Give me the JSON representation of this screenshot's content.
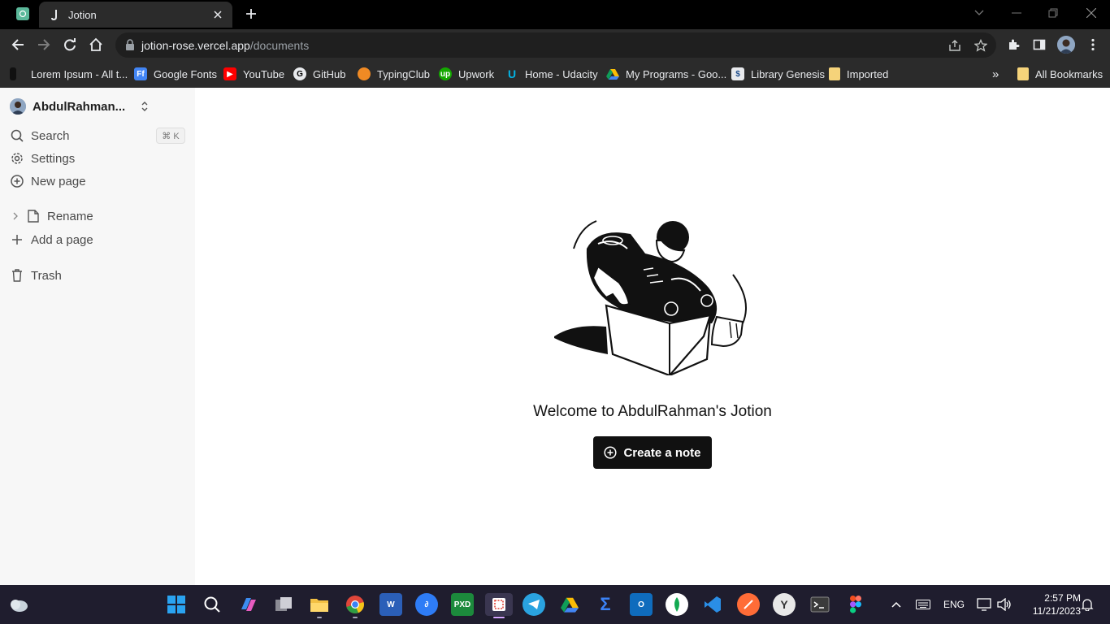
{
  "browser": {
    "tab_title": "Jotion",
    "url_host": "jotion-rose.vercel.app",
    "url_path": "/documents",
    "bookmarks": [
      {
        "label": "Lorem Ipsum - All t...",
        "icon": "lorem-icon",
        "color": "#333333"
      },
      {
        "label": "Google Fonts",
        "icon": "google-fonts-icon",
        "color": "#4285f4"
      },
      {
        "label": "YouTube",
        "icon": "youtube-icon",
        "color": "#ff0000"
      },
      {
        "label": "GitHub",
        "icon": "github-icon",
        "color": "#e8eaed"
      },
      {
        "label": "TypingClub",
        "icon": "typingclub-icon",
        "color": "#f08a24"
      },
      {
        "label": "Upwork",
        "icon": "upwork-icon",
        "color": "#14a800"
      },
      {
        "label": "Home - Udacity",
        "icon": "udacity-icon",
        "color": "#02b3e4"
      },
      {
        "label": "My Programs - Goo...",
        "icon": "google-drive-icon",
        "color": "#fbbc04"
      },
      {
        "label": "Library Genesis",
        "icon": "library-genesis-icon",
        "color": "#1f4e8c"
      },
      {
        "label": "Imported",
        "icon": "folder-icon",
        "color": "#f5d37a"
      }
    ],
    "all_bookmarks": "All Bookmarks",
    "overflow": "»"
  },
  "sidebar": {
    "user_name": "AbdulRahman...",
    "search_label": "Search",
    "search_shortcut": "⌘ K",
    "settings_label": "Settings",
    "new_page_label": "New page",
    "page_label": "Rename",
    "add_page_label": "Add a page",
    "trash_label": "Trash"
  },
  "main": {
    "welcome_text": "Welcome to AbdulRahman's Jotion",
    "create_button": "Create a note"
  },
  "taskbar": {
    "apps": [
      "windows-start-icon",
      "search-icon",
      "copilot-icon",
      "task-view-icon",
      "file-explorer-icon",
      "chrome-icon",
      "word-icon",
      "app-icon",
      "xd-icon",
      "snipping-tool-icon",
      "telegram-icon",
      "google-drive-icon",
      "terminal-sigma-icon",
      "outlook-icon",
      "mongodb-icon",
      "vscode-icon",
      "postman-icon",
      "app-y-icon",
      "windows-terminal-icon",
      "figma-icon"
    ],
    "language": "ENG",
    "time": "2:57 PM",
    "date": "11/21/2023"
  }
}
